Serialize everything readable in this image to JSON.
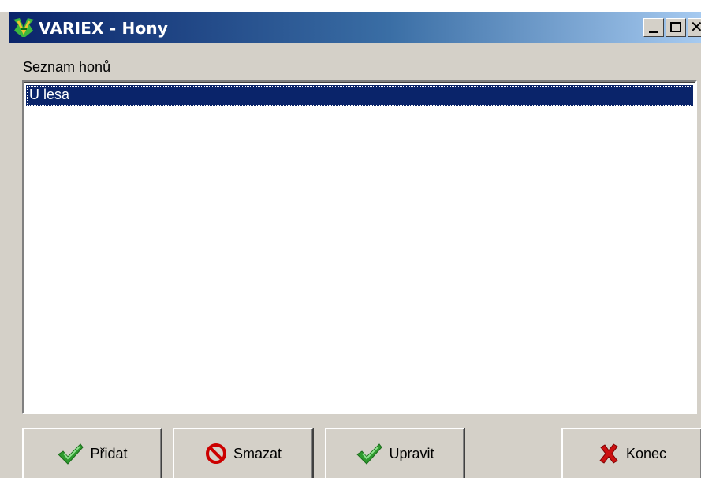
{
  "window": {
    "title": "VARIEX - Hony",
    "icons": {
      "app": "variex-app-icon",
      "minimize": "minimize-icon",
      "maximize": "maximize-icon",
      "close": "close-icon"
    }
  },
  "list": {
    "label": "Seznam honů",
    "items": [
      {
        "label": "U lesa",
        "selected": true
      }
    ]
  },
  "buttons": {
    "add": {
      "label": "Přidat",
      "icon": "green-check-icon"
    },
    "delete": {
      "label": "Smazat",
      "icon": "red-prohibition-icon"
    },
    "edit": {
      "label": "Upravit",
      "icon": "green-check-icon"
    },
    "end": {
      "label": "Konec",
      "icon": "red-x-icon"
    }
  },
  "colors": {
    "title_gradient_start": "#0a246a",
    "title_gradient_end": "#a6caf0",
    "selection": "#0a246a",
    "face": "#d4d0c8"
  }
}
